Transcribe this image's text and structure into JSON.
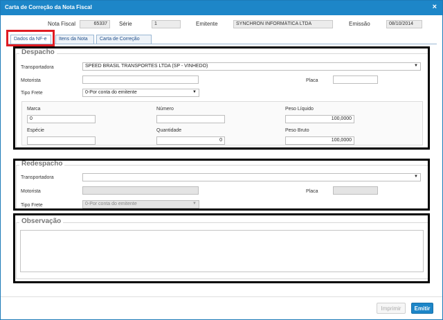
{
  "window": {
    "title": "Carta de Correção da Nota Fiscal",
    "close_glyph": "×"
  },
  "header": {
    "nota_fiscal_label": "Nota Fiscal",
    "nota_fiscal_value": "65337",
    "serie_label": "Série",
    "serie_value": "1",
    "emitente_label": "Emitente",
    "emitente_value": "SYNCHRON INFORMÁTICA LTDA",
    "emissao_label": "Emissão",
    "emissao_value": "08/10/2014"
  },
  "tabs": [
    {
      "label": "Dados da NF-e",
      "active": true
    },
    {
      "label": "Itens da Nota",
      "active": false
    },
    {
      "label": "Carta de Correção",
      "active": false
    }
  ],
  "despacho": {
    "legend": "Despacho",
    "transportadora_label": "Transportadora",
    "transportadora_value": "SPEED BRASIL TRANSPORTES LTDA (SP - VINHEDO)",
    "motorista_label": "Motorista",
    "motorista_value": "",
    "placa_label": "Placa",
    "placa_value": "",
    "tipo_frete_label": "Tipo Frete",
    "tipo_frete_value": "0-Por conta do emitente",
    "marca_label": "Marca",
    "marca_value": "0",
    "numero_label": "Número",
    "numero_value": "",
    "peso_liquido_label": "Peso Líquido",
    "peso_liquido_value": "100,0000",
    "especie_label": "Espécie",
    "especie_value": "",
    "quantidade_label": "Quantidade",
    "quantidade_value": "0",
    "peso_bruto_label": "Peso Bruto",
    "peso_bruto_value": "100,0000"
  },
  "redespacho": {
    "legend": "Redespacho",
    "transportadora_label": "Transportadora",
    "transportadora_value": "",
    "motorista_label": "Motorista",
    "motorista_value": "",
    "placa_label": "Placa",
    "placa_value": "",
    "tipo_frete_label": "Tipo Frete",
    "tipo_frete_value": "0-Por conta do emitente"
  },
  "observacao": {
    "legend": "Observação",
    "value": ""
  },
  "footer": {
    "imprimir_label": "Imprimir",
    "emitir_label": "Emitir"
  },
  "colors": {
    "titlebar": "#1d86c8",
    "highlight_red": "#e01b22",
    "annotation_black": "#000000",
    "primary_button": "#1d86c8"
  }
}
